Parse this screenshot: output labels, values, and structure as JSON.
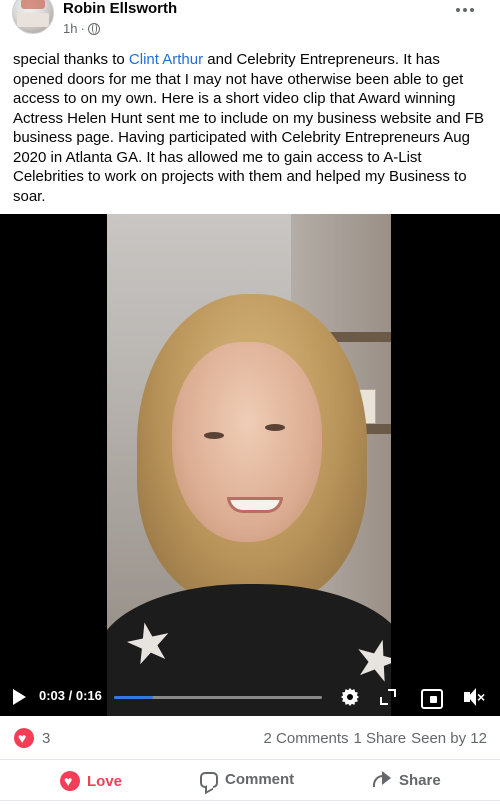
{
  "post": {
    "author": "Robin Ellsworth",
    "time": "1h",
    "separator": "·",
    "text_before_link": "special thanks to ",
    "link_text": "Clint Arthur",
    "text_after_link": " and Celebrity Entrepreneurs. It has opened doors for me that I may not have otherwise been able to get access to on my own. Here is a short video clip that Award winning Actress Helen Hunt sent me to include on my business website and FB business page. Having participated with Celebrity Entrepreneurs Aug 2020 in Atlanta GA.  It has allowed me to gain access to A-List Celebrities to work on projects with them and helped my Business to soar."
  },
  "video": {
    "time_display": "0:03 / 0:16",
    "progress_fraction": 0.1875
  },
  "stats": {
    "reactions_count": "3",
    "comments": "2 Comments",
    "shares": "1 Share",
    "seen_by": "Seen by 12"
  },
  "actions": {
    "love_label": "Love",
    "comment_label": "Comment",
    "share_label": "Share"
  },
  "icons": {
    "more": "more-options-icon",
    "globe": "globe-icon",
    "play": "play-icon",
    "settings": "gear-icon",
    "expand": "expand-icon",
    "pip": "picture-in-picture-icon",
    "mute": "muted-speaker-icon",
    "reaction": "love-reaction-icon",
    "comment": "comment-bubble-icon",
    "share": "share-arrow-icon"
  },
  "colors": {
    "link": "#216fdb",
    "love": "#f33e58",
    "progress": "#3578e5",
    "muted_text": "#65676b"
  }
}
